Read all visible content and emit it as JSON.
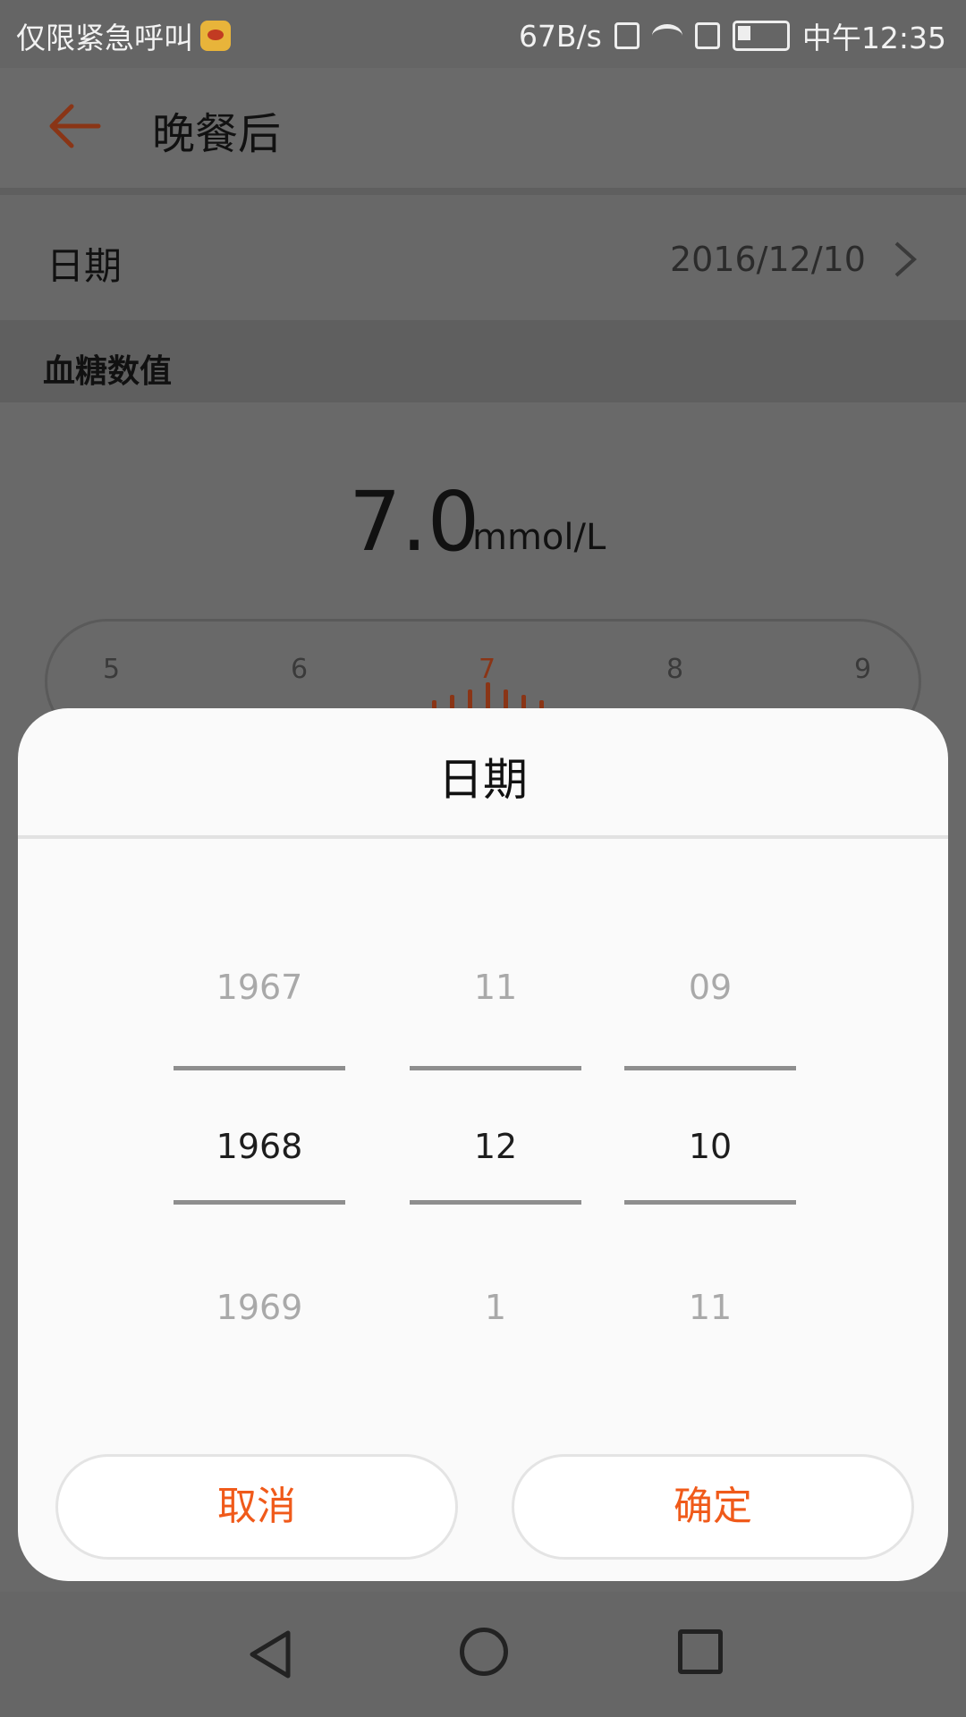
{
  "status_bar": {
    "carrier": "仅限紧急呼叫",
    "speed": "67B/s",
    "time": "中午12:35"
  },
  "app_bar": {
    "title": "晚餐后"
  },
  "date_row": {
    "label": "日期",
    "value": "2016/12/10"
  },
  "section": {
    "title": "血糖数值"
  },
  "reading": {
    "value": "7.0",
    "unit": "mmol/L"
  },
  "ruler": {
    "labels": [
      "5",
      "6",
      "7",
      "8",
      "9"
    ],
    "selected": "7"
  },
  "dialog": {
    "title": "日期",
    "year": {
      "prev": "1967",
      "selected": "1968",
      "next": "1969"
    },
    "month": {
      "prev": "11",
      "selected": "12",
      "next": "1"
    },
    "day": {
      "prev": "09",
      "selected": "10",
      "next": "11"
    },
    "cancel_label": "取消",
    "confirm_label": "确定"
  },
  "colors": {
    "accent": "#f05a1a",
    "dim_overlay": "#696969"
  }
}
